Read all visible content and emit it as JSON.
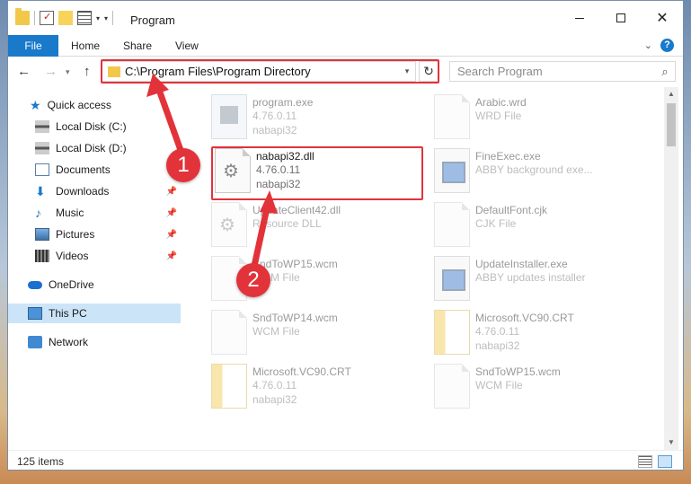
{
  "window": {
    "title": "Program",
    "colors": {
      "accent": "#1979ca",
      "highlight": "#e2333a",
      "selected": "#cce4f7"
    }
  },
  "ribbon": {
    "tabs": [
      "File",
      "Home",
      "Share",
      "View"
    ]
  },
  "navigation": {
    "address_path": "C:\\Program Files\\Program Directory",
    "search_placeholder": "Search Program"
  },
  "sidebar": {
    "items": [
      {
        "label": "Quick access",
        "icon": "star-icon"
      },
      {
        "label": "Local Disk (C:)",
        "icon": "disk-icon"
      },
      {
        "label": "Local Disk (D:)",
        "icon": "disk-icon"
      },
      {
        "label": "Documents",
        "icon": "documents-icon"
      },
      {
        "label": "Downloads",
        "icon": "download-icon"
      },
      {
        "label": "Music",
        "icon": "music-icon"
      },
      {
        "label": "Pictures",
        "icon": "pictures-icon"
      },
      {
        "label": "Videos",
        "icon": "videos-icon"
      },
      {
        "label": "OneDrive",
        "icon": "cloud-icon"
      },
      {
        "label": "This PC",
        "icon": "computer-icon",
        "selected": true
      },
      {
        "label": "Network",
        "icon": "network-icon"
      }
    ]
  },
  "files": [
    {
      "name": "program.exe",
      "line2": "4.76.0.11",
      "line3": "nabapi32",
      "icon": "app-icon"
    },
    {
      "name": "Arabic.wrd",
      "line2": "WRD File",
      "line3": "",
      "icon": "document-icon"
    },
    {
      "name": "nabapi32.dll",
      "line2": "4.76.0.11",
      "line3": "nabapi32",
      "icon": "gear-file-icon"
    },
    {
      "name": "FineExec.exe",
      "line2": "ABBY background exe...",
      "line3": "",
      "icon": "exe-icon"
    },
    {
      "name": "UpdateClient42.dll",
      "line2": "Resource DLL",
      "line3": "",
      "icon": "gear-file-icon"
    },
    {
      "name": "DefaultFont.cjk",
      "line2": "CJK File",
      "line3": "",
      "icon": "document-icon"
    },
    {
      "name": "SndToWP15.wcm",
      "line2": "WCM File",
      "line3": "",
      "icon": "document-icon"
    },
    {
      "name": "UpdateInstaller.exe",
      "line2": "ABBY updates installer",
      "line3": "",
      "icon": "exe-icon"
    },
    {
      "name": "SndToWP14.wcm",
      "line2": "WCM File",
      "line3": "",
      "icon": "document-icon"
    },
    {
      "name": "Microsoft.VC90.CRT",
      "line2": "4.76.0.11",
      "line3": "nabapi32",
      "icon": "zip-icon"
    },
    {
      "name": "Microsoft.VC90.CRT",
      "line2": "4.76.0.11",
      "line3": "nabapi32",
      "icon": "zip-icon"
    },
    {
      "name": "SndToWP15.wcm",
      "line2": "WCM File",
      "line3": "",
      "icon": "document-icon"
    }
  ],
  "status": {
    "item_count": "125 items"
  },
  "annotations": {
    "step1": "1",
    "step2": "2"
  }
}
